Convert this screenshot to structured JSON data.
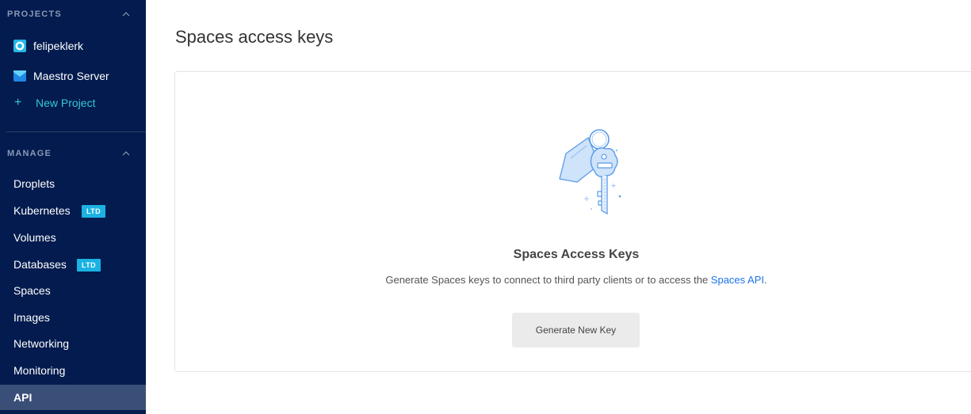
{
  "sidebar": {
    "projects_header": "PROJECTS",
    "projects": [
      {
        "label": "felipeklerk",
        "icon": "project-ring-icon"
      },
      {
        "label": "Maestro Server",
        "icon": "envelope-icon"
      }
    ],
    "new_project": {
      "plus": "+",
      "label": "New Project"
    },
    "manage_header": "MANAGE",
    "items": [
      {
        "label": "Droplets"
      },
      {
        "label": "Kubernetes",
        "badge": "LTD"
      },
      {
        "label": "Volumes"
      },
      {
        "label": "Databases",
        "badge": "LTD"
      },
      {
        "label": "Spaces"
      },
      {
        "label": "Images"
      },
      {
        "label": "Networking"
      },
      {
        "label": "Monitoring"
      },
      {
        "label": "API",
        "active": true
      }
    ]
  },
  "main": {
    "title": "Spaces access keys",
    "empty_state": {
      "illustration": "key-icon",
      "heading": "Spaces Access Keys",
      "desc_before": "Generate Spaces keys to connect to third party clients or to access the ",
      "desc_link": "Spaces API",
      "desc_after": ".",
      "button": "Generate New Key"
    }
  },
  "colors": {
    "sidebar_bg": "#031b4e",
    "active_item_bg": "#3a4f78",
    "accent": "#36c6d9",
    "badge": "#1ab2e2",
    "link": "#1a73e8"
  }
}
